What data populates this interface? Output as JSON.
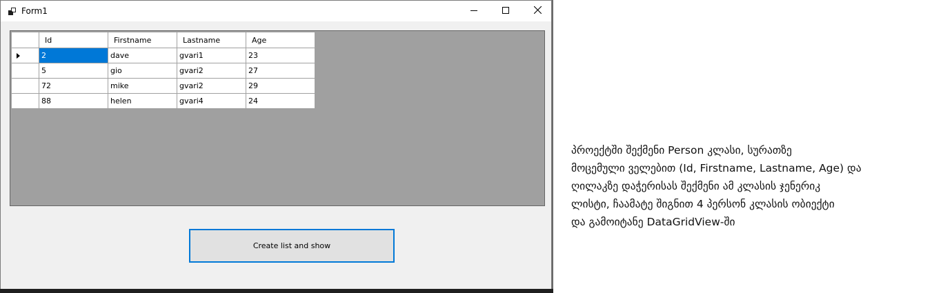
{
  "window": {
    "title": "Form1",
    "icon": "winforms-app-icon",
    "controls": {
      "minimize": "minimize-icon",
      "maximize": "maximize-icon",
      "close": "close-icon"
    }
  },
  "grid": {
    "columns": [
      "Id",
      "Firstname",
      "Lastname",
      "Age"
    ],
    "current_row_indicator": "row-pointer-icon",
    "rows": [
      {
        "id": "2",
        "firstname": "dave",
        "lastname": "gvari1",
        "age": "23"
      },
      {
        "id": "5",
        "firstname": "gio",
        "lastname": "gvari2",
        "age": "27"
      },
      {
        "id": "72",
        "firstname": "mike",
        "lastname": "gvari2",
        "age": "29"
      },
      {
        "id": "88",
        "firstname": "helen",
        "lastname": "gvari4",
        "age": "24"
      }
    ],
    "selection_color": "#0078d7",
    "background_color": "#a0a0a0"
  },
  "button": {
    "label": "Create list and show",
    "focus_border_color": "#0078d7"
  },
  "instructions": {
    "lines": [
      "პროექტში შექმენი Person კლასი, სურათზე",
      "მოცემული ველებით (Id, Firstname, Lastname, Age) და",
      "ღილაკზე დაჭერისას შექმენი ამ კლასის ჯენერიკ",
      "ლისტი, ჩაამატე შიგნით 4 პერსონ კლასის ობიექტი",
      "და გამოიტანე DataGridView-ში"
    ]
  }
}
